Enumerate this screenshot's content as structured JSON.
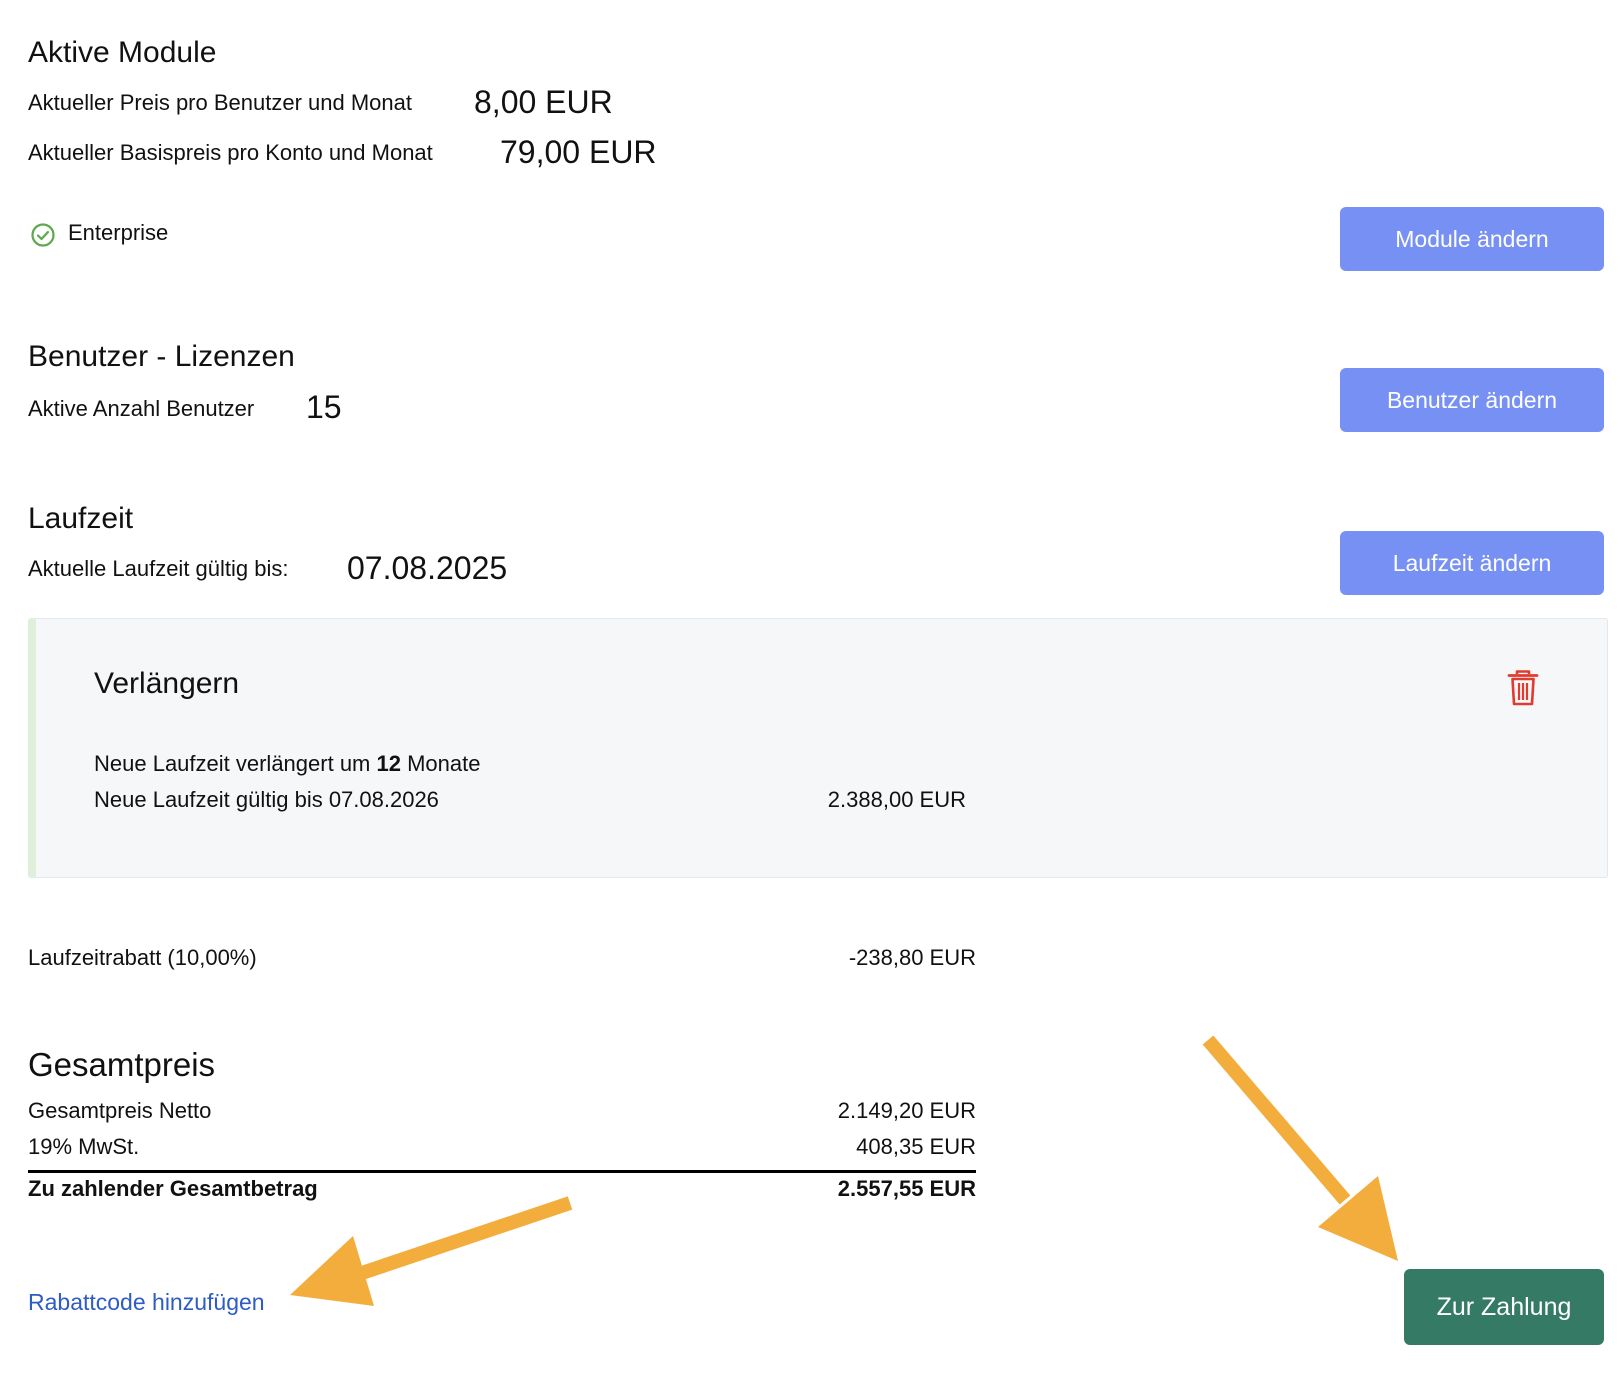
{
  "modules": {
    "title": "Aktive Module",
    "price_user_label": "Aktueller Preis pro Benutzer und Monat",
    "price_user_value": "8,00 EUR",
    "base_price_label": "Aktueller Basispreis pro Konto und Monat",
    "base_price_value": "79,00 EUR",
    "active_plan": "Enterprise",
    "change_button": "Module ändern"
  },
  "users": {
    "title": "Benutzer - Lizenzen",
    "active_label": "Aktive Anzahl Benutzer",
    "active_value": "15",
    "change_button": "Benutzer ändern"
  },
  "term": {
    "title": "Laufzeit",
    "valid_label": "Aktuelle Laufzeit gültig bis:",
    "valid_value": "07.08.2025",
    "change_button": "Laufzeit ändern"
  },
  "extend": {
    "title": "Verlängern",
    "line1_prefix": "Neue Laufzeit verlängert um ",
    "line1_months": "12",
    "line1_suffix": " Monate",
    "line2": "Neue Laufzeit gültig bis 07.08.2026",
    "price": "2.388,00 EUR",
    "delete_icon": "trash-icon"
  },
  "discount": {
    "label": "Laufzeitrabatt (10,00%)",
    "value": "-238,80 EUR"
  },
  "total": {
    "title": "Gesamtpreis",
    "net_label": "Gesamtpreis Netto",
    "net_value": "2.149,20 EUR",
    "vat_label": "19% MwSt.",
    "vat_value": "408,35 EUR",
    "sum_label": "Zu zahlender Gesamtbetrag",
    "sum_value": "2.557,55 EUR"
  },
  "footer": {
    "coupon_link": "Rabattcode hinzufügen",
    "pay_button": "Zur Zahlung"
  },
  "colors": {
    "primary_button": "#7690f4",
    "pay_button": "#357a64",
    "link": "#2e5bc6",
    "annotation_arrow": "#f2ad3c",
    "check_icon": "#5aa94b",
    "trash_icon": "#e23a2e"
  }
}
